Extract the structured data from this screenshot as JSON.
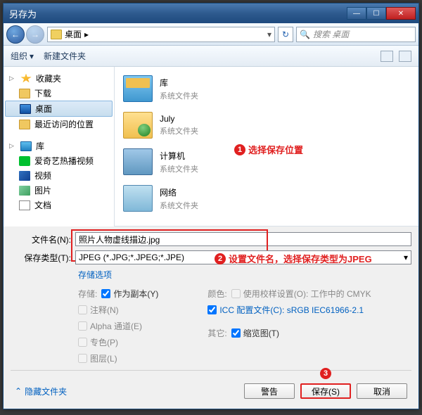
{
  "title": "另存为",
  "nav": {
    "path_label": "桌面",
    "path_arrow": "▸",
    "search_placeholder": "搜索 桌面"
  },
  "toolbar": {
    "organize": "组织",
    "new_folder": "新建文件夹"
  },
  "sidebar": {
    "favorites": {
      "header": "收藏夹",
      "items": [
        "下载",
        "桌面",
        "最近访问的位置"
      ]
    },
    "libraries": {
      "header": "库",
      "items": [
        "爱奇艺热播视频",
        "视频",
        "图片",
        "文档"
      ]
    }
  },
  "files": [
    {
      "name": "库",
      "sub": "系统文件夹"
    },
    {
      "name": "July",
      "sub": "系统文件夹"
    },
    {
      "name": "计算机",
      "sub": "系统文件夹"
    },
    {
      "name": "网络",
      "sub": "系统文件夹"
    }
  ],
  "annotations": {
    "a1": "选择保存位置",
    "a2": "设置文件名，选择保存类型为JPEG"
  },
  "fields": {
    "filename_label": "文件名(N):",
    "filename_value": "照片人物虚线描边.jpg",
    "filetype_label": "保存类型(T):",
    "filetype_value": "JPEG (*.JPG;*.JPEG;*.JPE)",
    "save_options": "存储选项",
    "store_label": "存储:",
    "copy": "作为副本(Y)",
    "notes": "注释(N)",
    "alpha": "Alpha 通道(E)",
    "spot": "专色(P)",
    "layers": "图层(L)",
    "color_label": "颜色:",
    "proof": "使用校样设置(O): 工作中的 CMYK",
    "icc": "ICC 配置文件(C):",
    "icc_value": "sRGB IEC61966-2.1",
    "other_label": "其它:",
    "thumbnail": "缩览图(T)"
  },
  "buttons": {
    "hide_folders": "隐藏文件夹",
    "warn": "警告",
    "save": "保存(S)",
    "cancel": "取消"
  }
}
